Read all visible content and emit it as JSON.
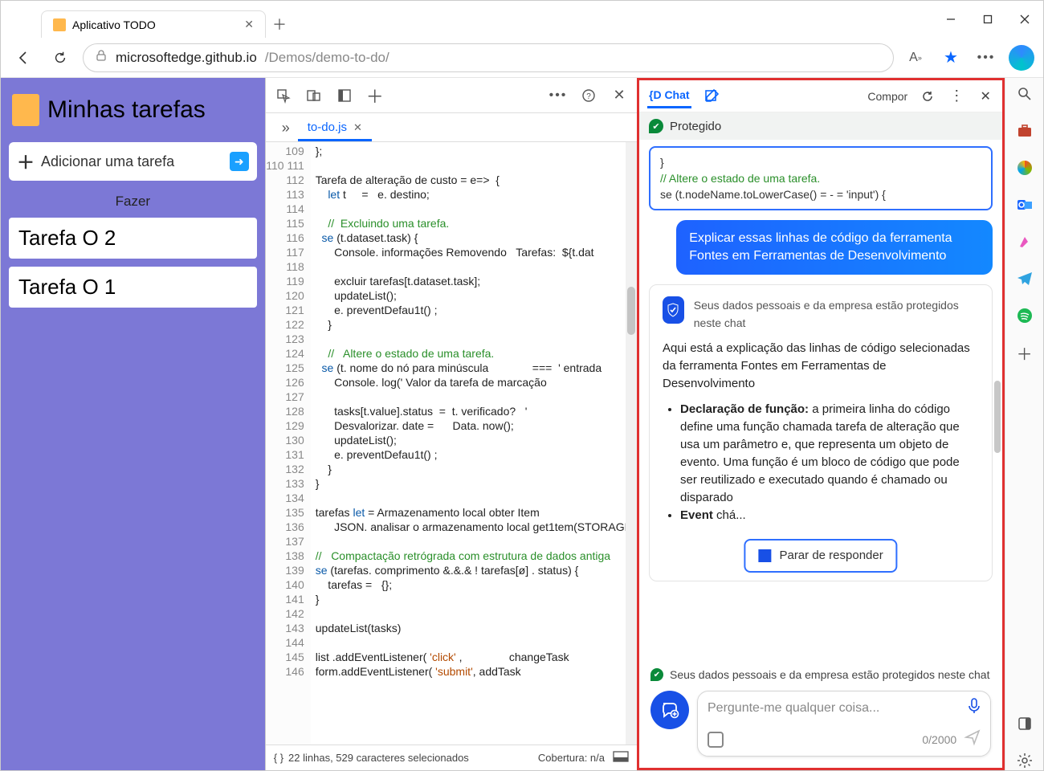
{
  "window": {
    "tab_title": "Aplicativo TODO",
    "url_host": "microsoftedge.github.io",
    "url_path": "/Demos/demo-to-do/"
  },
  "app": {
    "title": "Minhas tarefas",
    "add_placeholder": "Adicionar uma tarefa",
    "section": "Fazer",
    "tasks": [
      "Tarefa O 2",
      "Tarefa O 1"
    ]
  },
  "devtools": {
    "file_tab": "to-do.js",
    "status_left": "22 linhas, 529 caracteres selecionados",
    "status_cov": "Cobertura: n/a",
    "line_start": 109,
    "lines": [
      "};",
      "",
      "Tarefa de alteração de custo = e=>  {",
      "    let t     =   e. destino;",
      "",
      "    //  Excluindo uma tarefa.",
      "  se (t.dataset.task) {",
      "      Console. informações Removendo   Tarefas:  ${t.dat",
      "",
      "      excluir tarefas[t.dataset.task];",
      "      updateList();",
      "      e. preventDefau1t() ;",
      "    }",
      "",
      "    //   Altere o estado de uma tarefa.",
      "  se (t. nome do nó para minúscula              ===  ' entrada",
      "      Console. log(' Valor da tarefa de marcação",
      "",
      "      tasks[t.value].status  =  t. verificado?   '",
      "      Desvalorizar. date =      Data. now();",
      "      updateList();",
      "      e. preventDefau1t() ;",
      "    }",
      "}",
      "",
      "tarefas let = Armazenamento local obter Item",
      "      JSON. analisar o armazenamento local get1tem(STORAGE",
      "",
      "//   Compactação retrógrada com estrutura de dados antiga",
      "se (tarefas. comprimento &amp;.&amp;.&amp; ! tarefas[ø] . status) {",
      "    tarefas =   {};",
      "}",
      "",
      "updateList(tasks)",
      "",
      "list .addEventListener( 'click' ,               changeTask",
      "form.addEventListener( 'submit', addTask",
      ""
    ]
  },
  "copilot": {
    "tab_chat": "{D Chat",
    "tab_compose": "Compor",
    "protected_bar": "Protegido",
    "snippet": [
      "}",
      "// Altere o estado de uma tarefa.",
      "se (t.nodeName.toLowerCase() = - = 'input') {"
    ],
    "user_query": "Explicar essas linhas de código da ferramenta Fontes em Ferramentas de Desenvolvimento",
    "ai_header": "Seus dados pessoais e da empresa estão protegidos neste chat",
    "ai_intro": "Aqui está a explicação das linhas de código selecionadas da ferramenta Fontes em Ferramentas de Desenvolvimento",
    "ai_bullet1_strong": "Declaração de função:",
    "ai_bullet1_body": "a primeira linha do código define uma função chamada tarefa de alteração que usa um parâmetro e, que representa um objeto de evento. Uma função é um bloco de código que pode ser reutilizado e executado quando é chamado ou disparado",
    "ai_bullet2_strong": "Event",
    "ai_bullet2_body": "chá...",
    "stop_label": "Parar de responder",
    "footer_note": "Seus dados pessoais e da empresa estão protegidos neste chat",
    "ask_placeholder": "Pergunte-me qualquer coisa...",
    "counter": "0/2000"
  },
  "rail_icons": [
    "search",
    "briefcase",
    "office",
    "outlook",
    "brush",
    "send",
    "spotify"
  ]
}
